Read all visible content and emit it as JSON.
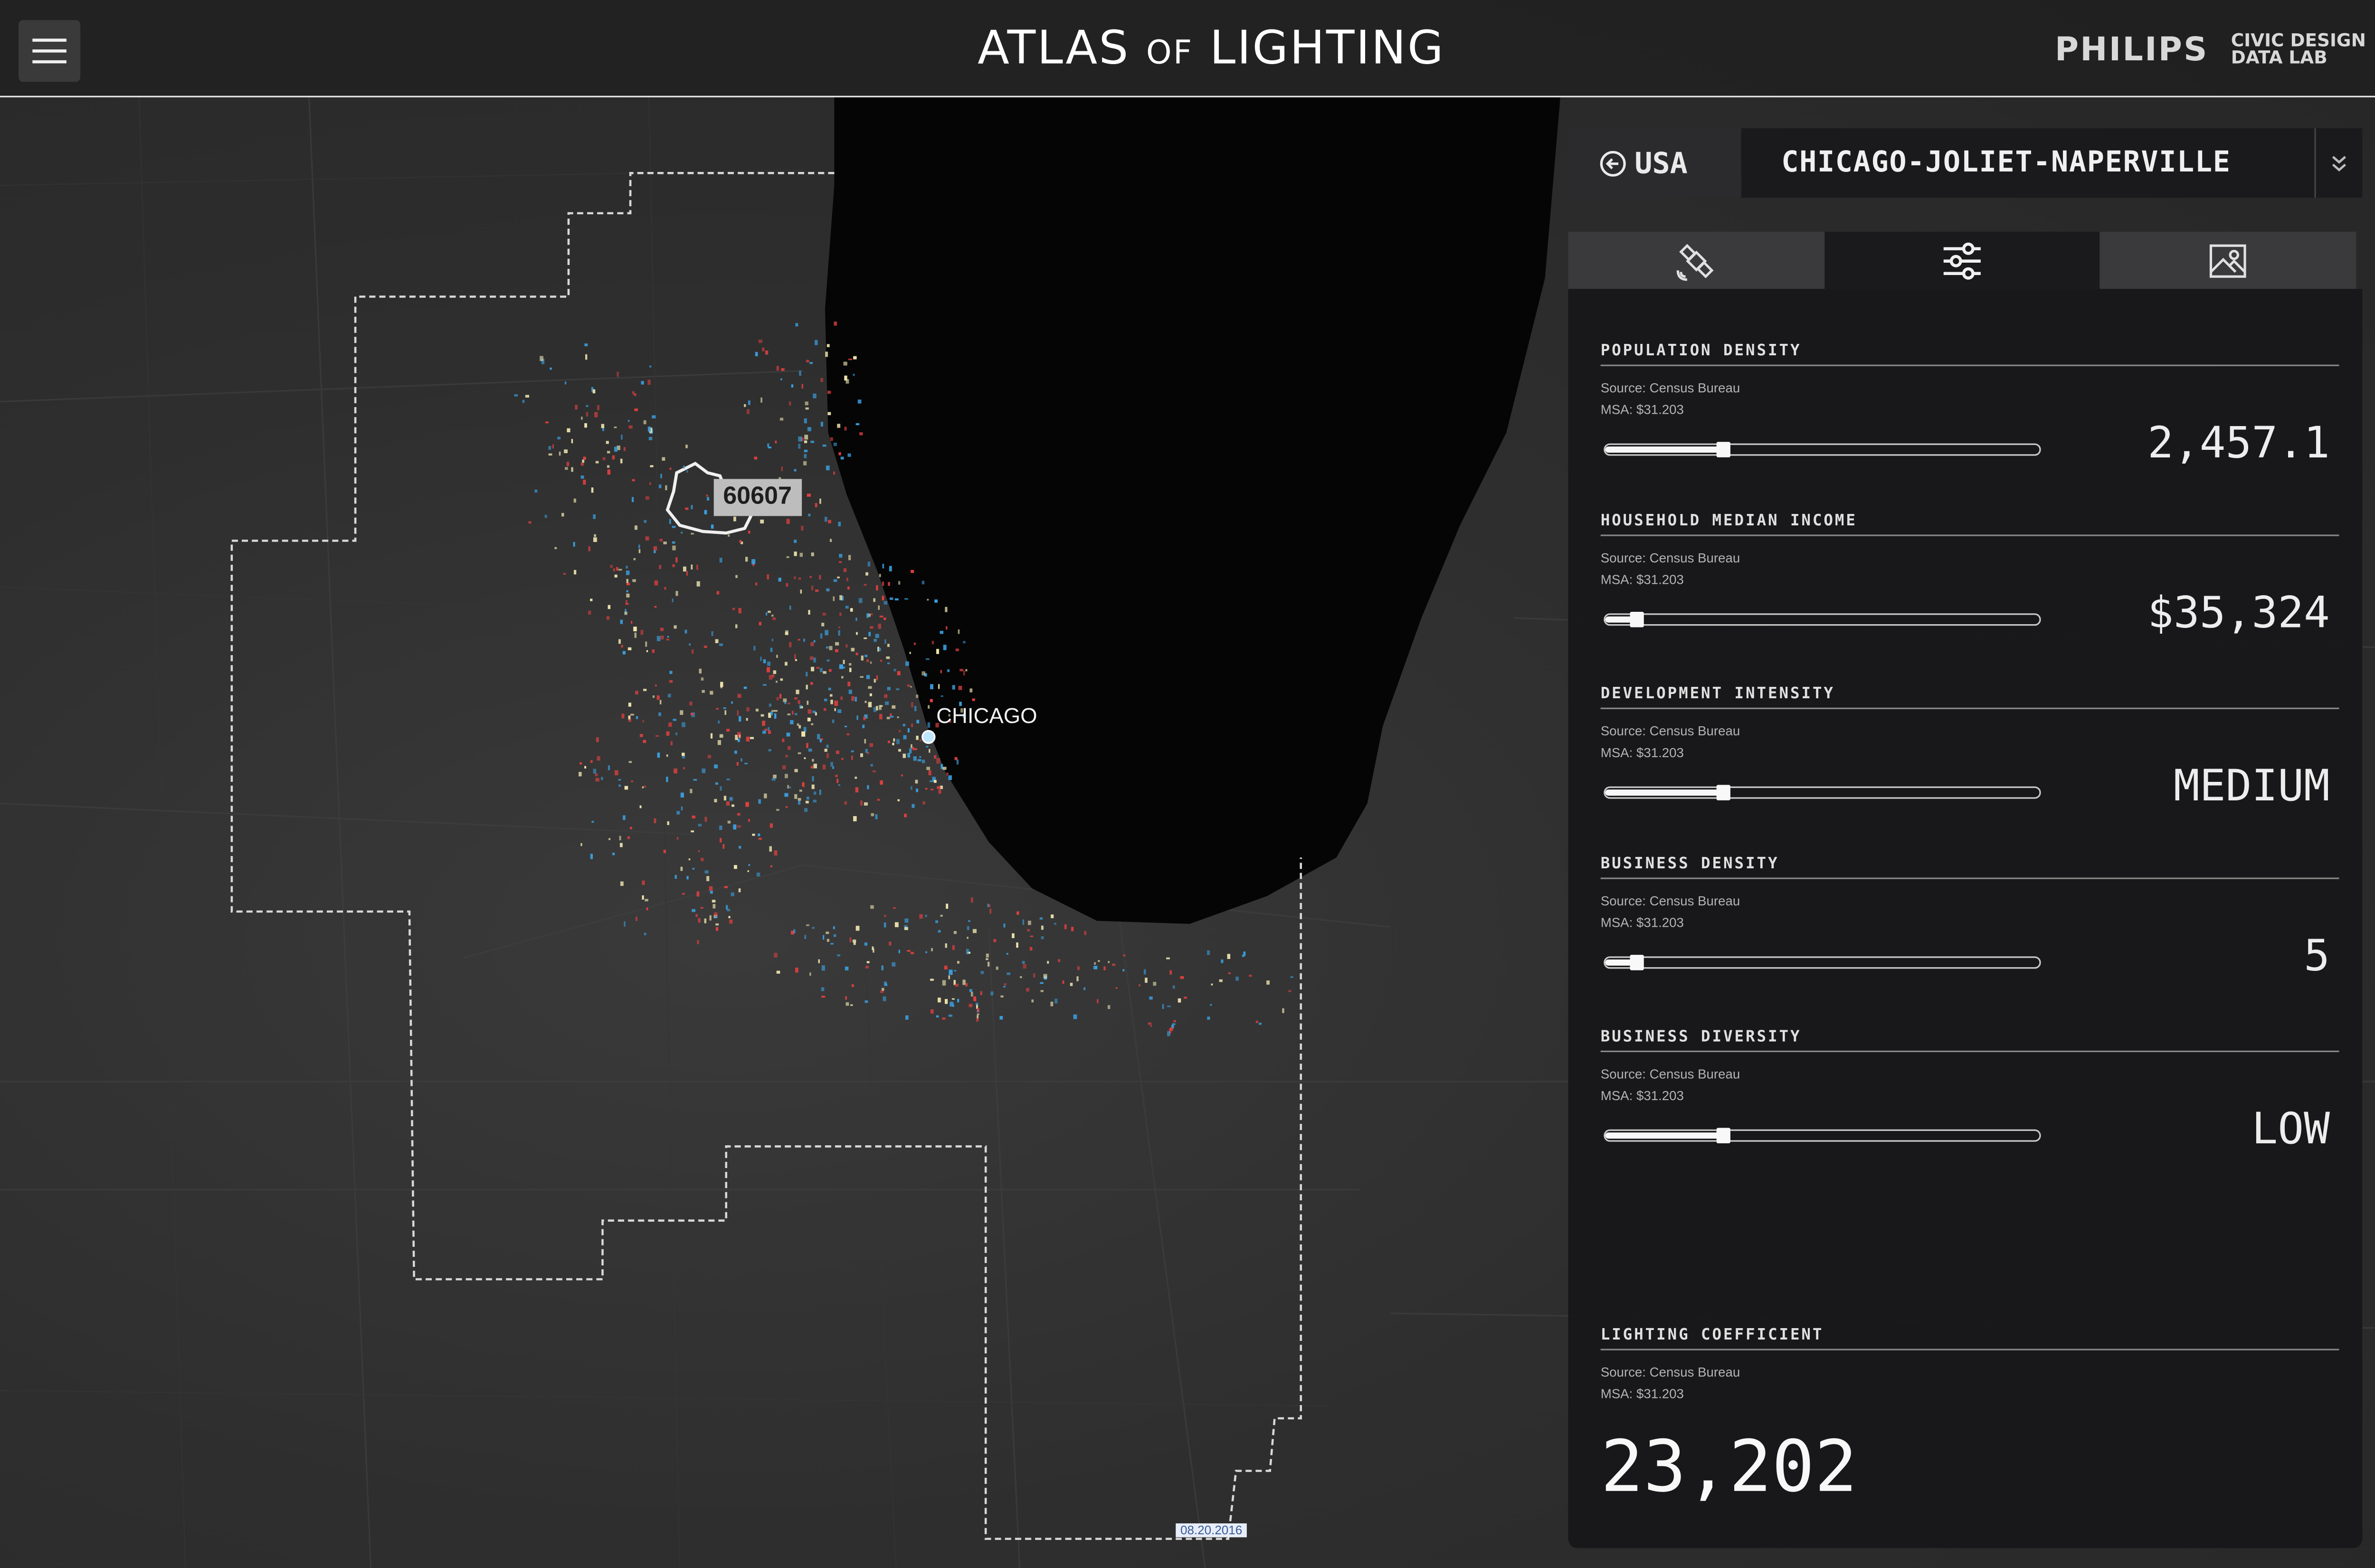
{
  "header": {
    "title_pre": "ATLAS",
    "title_of": "OF",
    "title_post": "LIGHTING",
    "brand_philips": "PHILIPS",
    "brand_cdl_line1": "CIVIC DESIGN",
    "brand_cdl_line2": "DATA LAB"
  },
  "map": {
    "city_label": "CHICAGO",
    "zip_label": "60607",
    "date_tag": "08.20.2016"
  },
  "nav": {
    "back_label": "USA",
    "msa_name": "CHICAGO-JOLIET-NAPERVILLE"
  },
  "tabs": [
    {
      "icon": "satellite-icon",
      "active": false
    },
    {
      "icon": "sliders-icon",
      "active": true
    },
    {
      "icon": "image-icon",
      "active": false
    }
  ],
  "metrics": [
    {
      "label": "POPULATION DENSITY",
      "source": "Source: Census Bureau",
      "msa": "MSA: $31.203",
      "value": "2,457.1",
      "level": 0.27
    },
    {
      "label": "HOUSEHOLD MEDIAN INCOME",
      "source": "Source: Census Bureau",
      "msa": "MSA: $31.203",
      "value": "$35,324",
      "level": 0.07
    },
    {
      "label": "DEVELOPMENT INTENSITY",
      "source": "Source: Census Bureau",
      "msa": "MSA: $31.203",
      "value": "MEDIUM",
      "level": 0.27
    },
    {
      "label": "BUSINESS DENSITY",
      "source": "Source: Census Bureau",
      "msa": "MSA: $31.203",
      "value": "5",
      "level": 0.07
    },
    {
      "label": "BUSINESS DIVERSITY",
      "source": "Source: Census Bureau",
      "msa": "MSA: $31.203",
      "value": "LOW",
      "level": 0.27
    }
  ],
  "coefficient": {
    "label": "LIGHTING COEFFICIENT",
    "source": "Source: Census Bureau",
    "msa": "MSA: $31.203",
    "value": "23,202"
  },
  "colors": {
    "lake": "#050505",
    "boundary": "#e0e0e0",
    "light_red": "#e04040",
    "light_blue": "#3aa0e0",
    "light_warm": "#f0e6b0"
  }
}
